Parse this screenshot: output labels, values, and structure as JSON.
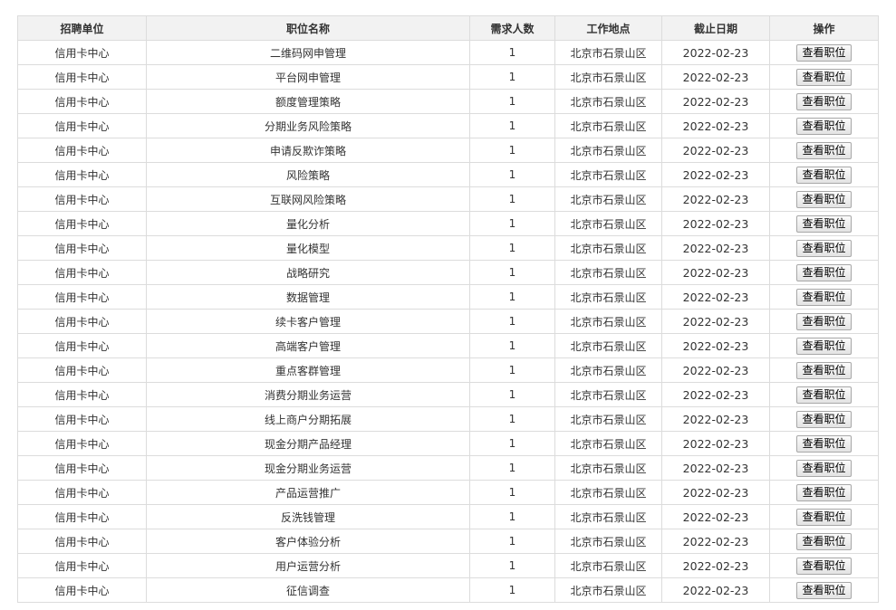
{
  "table": {
    "headers": [
      "招聘单位",
      "职位名称",
      "需求人数",
      "工作地点",
      "截止日期",
      "操作"
    ],
    "button_label": "查看职位",
    "rows": [
      {
        "unit": "信用卡中心",
        "title": "二维码网申管理",
        "count": "1",
        "location": "北京市石景山区",
        "deadline": "2022-02-23"
      },
      {
        "unit": "信用卡中心",
        "title": "平台网申管理",
        "count": "1",
        "location": "北京市石景山区",
        "deadline": "2022-02-23"
      },
      {
        "unit": "信用卡中心",
        "title": "额度管理策略",
        "count": "1",
        "location": "北京市石景山区",
        "deadline": "2022-02-23"
      },
      {
        "unit": "信用卡中心",
        "title": "分期业务风险策略",
        "count": "1",
        "location": "北京市石景山区",
        "deadline": "2022-02-23"
      },
      {
        "unit": "信用卡中心",
        "title": "申请反欺诈策略",
        "count": "1",
        "location": "北京市石景山区",
        "deadline": "2022-02-23"
      },
      {
        "unit": "信用卡中心",
        "title": "风险策略",
        "count": "1",
        "location": "北京市石景山区",
        "deadline": "2022-02-23"
      },
      {
        "unit": "信用卡中心",
        "title": "互联网风险策略",
        "count": "1",
        "location": "北京市石景山区",
        "deadline": "2022-02-23"
      },
      {
        "unit": "信用卡中心",
        "title": "量化分析",
        "count": "1",
        "location": "北京市石景山区",
        "deadline": "2022-02-23"
      },
      {
        "unit": "信用卡中心",
        "title": "量化模型",
        "count": "1",
        "location": "北京市石景山区",
        "deadline": "2022-02-23"
      },
      {
        "unit": "信用卡中心",
        "title": "战略研究",
        "count": "1",
        "location": "北京市石景山区",
        "deadline": "2022-02-23"
      },
      {
        "unit": "信用卡中心",
        "title": "数据管理",
        "count": "1",
        "location": "北京市石景山区",
        "deadline": "2022-02-23"
      },
      {
        "unit": "信用卡中心",
        "title": "续卡客户管理",
        "count": "1",
        "location": "北京市石景山区",
        "deadline": "2022-02-23"
      },
      {
        "unit": "信用卡中心",
        "title": "高端客户管理",
        "count": "1",
        "location": "北京市石景山区",
        "deadline": "2022-02-23"
      },
      {
        "unit": "信用卡中心",
        "title": "重点客群管理",
        "count": "1",
        "location": "北京市石景山区",
        "deadline": "2022-02-23"
      },
      {
        "unit": "信用卡中心",
        "title": "消费分期业务运营",
        "count": "1",
        "location": "北京市石景山区",
        "deadline": "2022-02-23"
      },
      {
        "unit": "信用卡中心",
        "title": "线上商户分期拓展",
        "count": "1",
        "location": "北京市石景山区",
        "deadline": "2022-02-23"
      },
      {
        "unit": "信用卡中心",
        "title": "现金分期产品经理",
        "count": "1",
        "location": "北京市石景山区",
        "deadline": "2022-02-23"
      },
      {
        "unit": "信用卡中心",
        "title": "现金分期业务运营",
        "count": "1",
        "location": "北京市石景山区",
        "deadline": "2022-02-23"
      },
      {
        "unit": "信用卡中心",
        "title": "产品运营推广",
        "count": "1",
        "location": "北京市石景山区",
        "deadline": "2022-02-23"
      },
      {
        "unit": "信用卡中心",
        "title": "反洗钱管理",
        "count": "1",
        "location": "北京市石景山区",
        "deadline": "2022-02-23"
      },
      {
        "unit": "信用卡中心",
        "title": "客户体验分析",
        "count": "1",
        "location": "北京市石景山区",
        "deadline": "2022-02-23"
      },
      {
        "unit": "信用卡中心",
        "title": "用户运营分析",
        "count": "1",
        "location": "北京市石景山区",
        "deadline": "2022-02-23"
      },
      {
        "unit": "信用卡中心",
        "title": "征信调查",
        "count": "1",
        "location": "北京市石景山区",
        "deadline": "2022-02-23"
      }
    ]
  }
}
